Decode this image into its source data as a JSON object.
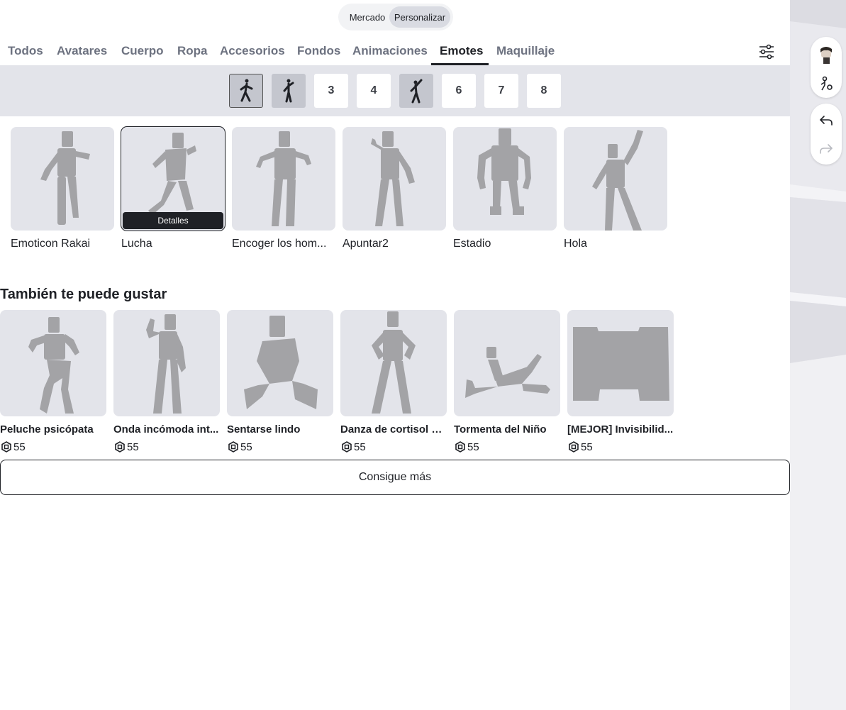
{
  "toggle": {
    "market": "Mercado",
    "customize": "Personalizar"
  },
  "tabs": [
    "Todos",
    "Avatares",
    "Cuerpo",
    "Ropa",
    "Accesorios",
    "Fondos",
    "Animaciones",
    "Emotes",
    "Maquillaje"
  ],
  "active_tab": "Emotes",
  "slots": [
    "",
    "",
    "3",
    "4",
    "",
    "6",
    "7",
    "8"
  ],
  "equipped": [
    {
      "name": "Emoticon Rakai"
    },
    {
      "name": "Lucha",
      "details": "Detalles"
    },
    {
      "name": "Encoger los hom..."
    },
    {
      "name": "Apuntar2"
    },
    {
      "name": "Estadio"
    },
    {
      "name": "Hola"
    }
  ],
  "recommended_title": "También te puede gustar",
  "recommended": [
    {
      "name": "Peluche psicópata",
      "price": "55"
    },
    {
      "name": "Onda incómoda int...",
      "price": "55"
    },
    {
      "name": "Sentarse lindo",
      "price": "55"
    },
    {
      "name": "Danza de cortisol b...",
      "price": "55"
    },
    {
      "name": "Tormenta del Niño",
      "price": "55"
    },
    {
      "name": "[MEJOR] Invisibilid...",
      "price": "55"
    }
  ],
  "more_button": "Consigue más",
  "colors": {
    "text": "#1f2126",
    "muted": "#6d7280",
    "tile": "#e3e4ea",
    "figure": "#a3a3a6"
  },
  "icons": [
    "filter-icon",
    "avatar-thumbnail",
    "avatar-settings-icon",
    "undo-icon",
    "redo-icon",
    "robux-icon"
  ]
}
